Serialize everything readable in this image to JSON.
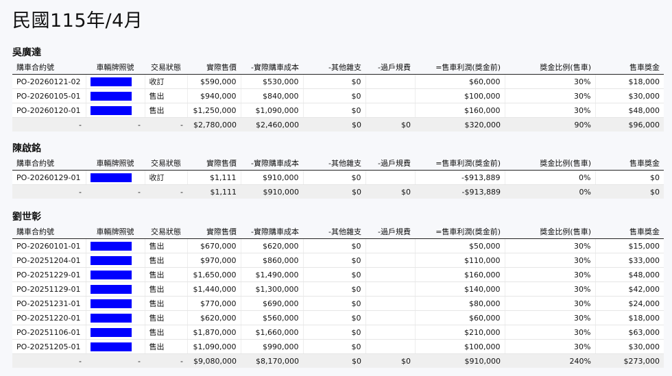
{
  "page": {
    "title": "民國115年/4月"
  },
  "headers": [
    "購車合約號",
    "車輛牌照號",
    "交易狀態",
    "實際售價",
    "-實際購車成本",
    "-其他雜支",
    "-過戶規費",
    "=售車利潤(獎金前)",
    "獎金比例(售車)",
    "售車獎金"
  ],
  "colors": {
    "plate": "#0000ff",
    "total_bg": "#efefef"
  },
  "sections": [
    {
      "name": "吳廣達",
      "rows": [
        [
          "PO-20260121-02",
          "",
          "收訂",
          "$590,000",
          "$530,000",
          "$0",
          "",
          "$60,000",
          "30%",
          "$18,000"
        ],
        [
          "PO-20260105-01",
          "",
          "售出",
          "$940,000",
          "$840,000",
          "$0",
          "",
          "$100,000",
          "30%",
          "$30,000"
        ],
        [
          "PO-20260120-01",
          "",
          "售出",
          "$1,250,000",
          "$1,090,000",
          "$0",
          "",
          "$160,000",
          "30%",
          "$48,000"
        ]
      ],
      "total": [
        "-",
        "-",
        "-",
        "$2,780,000",
        "$2,460,000",
        "$0",
        "$0",
        "$320,000",
        "90%",
        "$96,000"
      ]
    },
    {
      "name": "陳啟銘",
      "rows": [
        [
          "PO-20260129-01",
          "",
          "收訂",
          "$1,111",
          "$910,000",
          "$0",
          "",
          "-$913,889",
          "0%",
          "$0"
        ]
      ],
      "total": [
        "-",
        "-",
        "-",
        "$1,111",
        "$910,000",
        "$0",
        "$0",
        "-$913,889",
        "0%",
        "$0"
      ]
    },
    {
      "name": "劉世彰",
      "rows": [
        [
          "PO-20260101-01",
          "",
          "售出",
          "$670,000",
          "$620,000",
          "$0",
          "",
          "$50,000",
          "30%",
          "$15,000"
        ],
        [
          "PO-20251204-01",
          "",
          "售出",
          "$970,000",
          "$860,000",
          "$0",
          "",
          "$110,000",
          "30%",
          "$33,000"
        ],
        [
          "PO-20251229-01",
          "",
          "售出",
          "$1,650,000",
          "$1,490,000",
          "$0",
          "",
          "$160,000",
          "30%",
          "$48,000"
        ],
        [
          "PO-20251129-01",
          "",
          "售出",
          "$1,440,000",
          "$1,300,000",
          "$0",
          "",
          "$140,000",
          "30%",
          "$42,000"
        ],
        [
          "PO-20251231-01",
          "",
          "售出",
          "$770,000",
          "$690,000",
          "$0",
          "",
          "$80,000",
          "30%",
          "$24,000"
        ],
        [
          "PO-20251220-01",
          "",
          "售出",
          "$620,000",
          "$560,000",
          "$0",
          "",
          "$60,000",
          "30%",
          "$18,000"
        ],
        [
          "PO-20251106-01",
          "",
          "售出",
          "$1,870,000",
          "$1,660,000",
          "$0",
          "",
          "$210,000",
          "30%",
          "$63,000"
        ],
        [
          "PO-20251205-01",
          "",
          "售出",
          "$1,090,000",
          "$990,000",
          "$0",
          "",
          "$100,000",
          "30%",
          "$30,000"
        ]
      ],
      "total": [
        "-",
        "-",
        "-",
        "$9,080,000",
        "$8,170,000",
        "$0",
        "$0",
        "$910,000",
        "240%",
        "$273,000"
      ]
    }
  ]
}
